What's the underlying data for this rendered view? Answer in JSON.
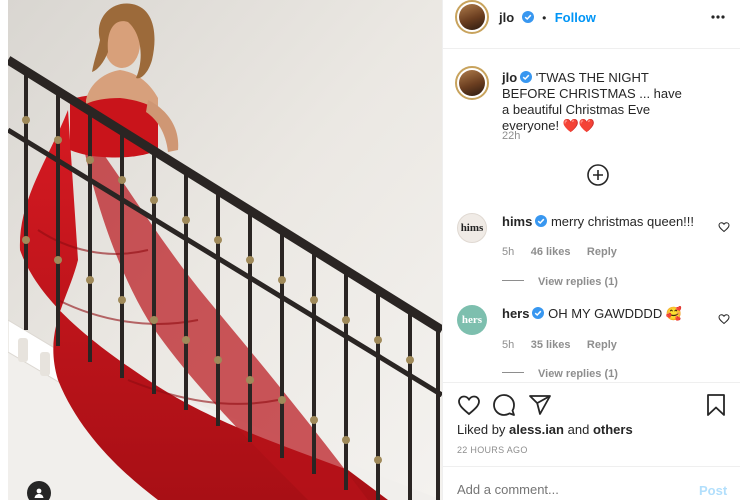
{
  "post": {
    "username": "jlo",
    "follow_label": "Follow",
    "separator": "•",
    "more_icon": "more-horizontal-icon"
  },
  "caption": {
    "username": "jlo",
    "text": "'TWAS THE NIGHT BEFORE CHRISTMAS ... have a beautiful Christmas Eve everyone! ❤️❤️",
    "time": "22h"
  },
  "add_icon": "plus-circle-icon",
  "comments": [
    {
      "avatar_text": "hims",
      "username": "hims",
      "text": "merry christmas queen!!!",
      "time": "5h",
      "likes": "46 likes",
      "reply_label": "Reply",
      "view_replies": "View replies (1)",
      "avatar_bg": "#f0ebe6",
      "avatar_fg": "#222222"
    },
    {
      "avatar_text": "hers",
      "username": "hers",
      "text": "OH MY GAWDDDD 🥰",
      "time": "5h",
      "likes": "35 likes",
      "reply_label": "Reply",
      "view_replies": "View replies (1)",
      "avatar_bg": "#7dbfae",
      "avatar_fg": "#ffffff"
    }
  ],
  "actions": {
    "liked_by_prefix": "Liked by",
    "liked_by_user": "aless.ian",
    "liked_by_and": "and",
    "liked_by_others": "others",
    "timestamp": "22 HOURS AGO"
  },
  "comment_box": {
    "placeholder": "Add a comment...",
    "post_label": "Post"
  },
  "colors": {
    "accent": "#0095f6",
    "verified": "#3897f0",
    "post_disabled": "#b2dffc",
    "dress": "#c8161d"
  }
}
